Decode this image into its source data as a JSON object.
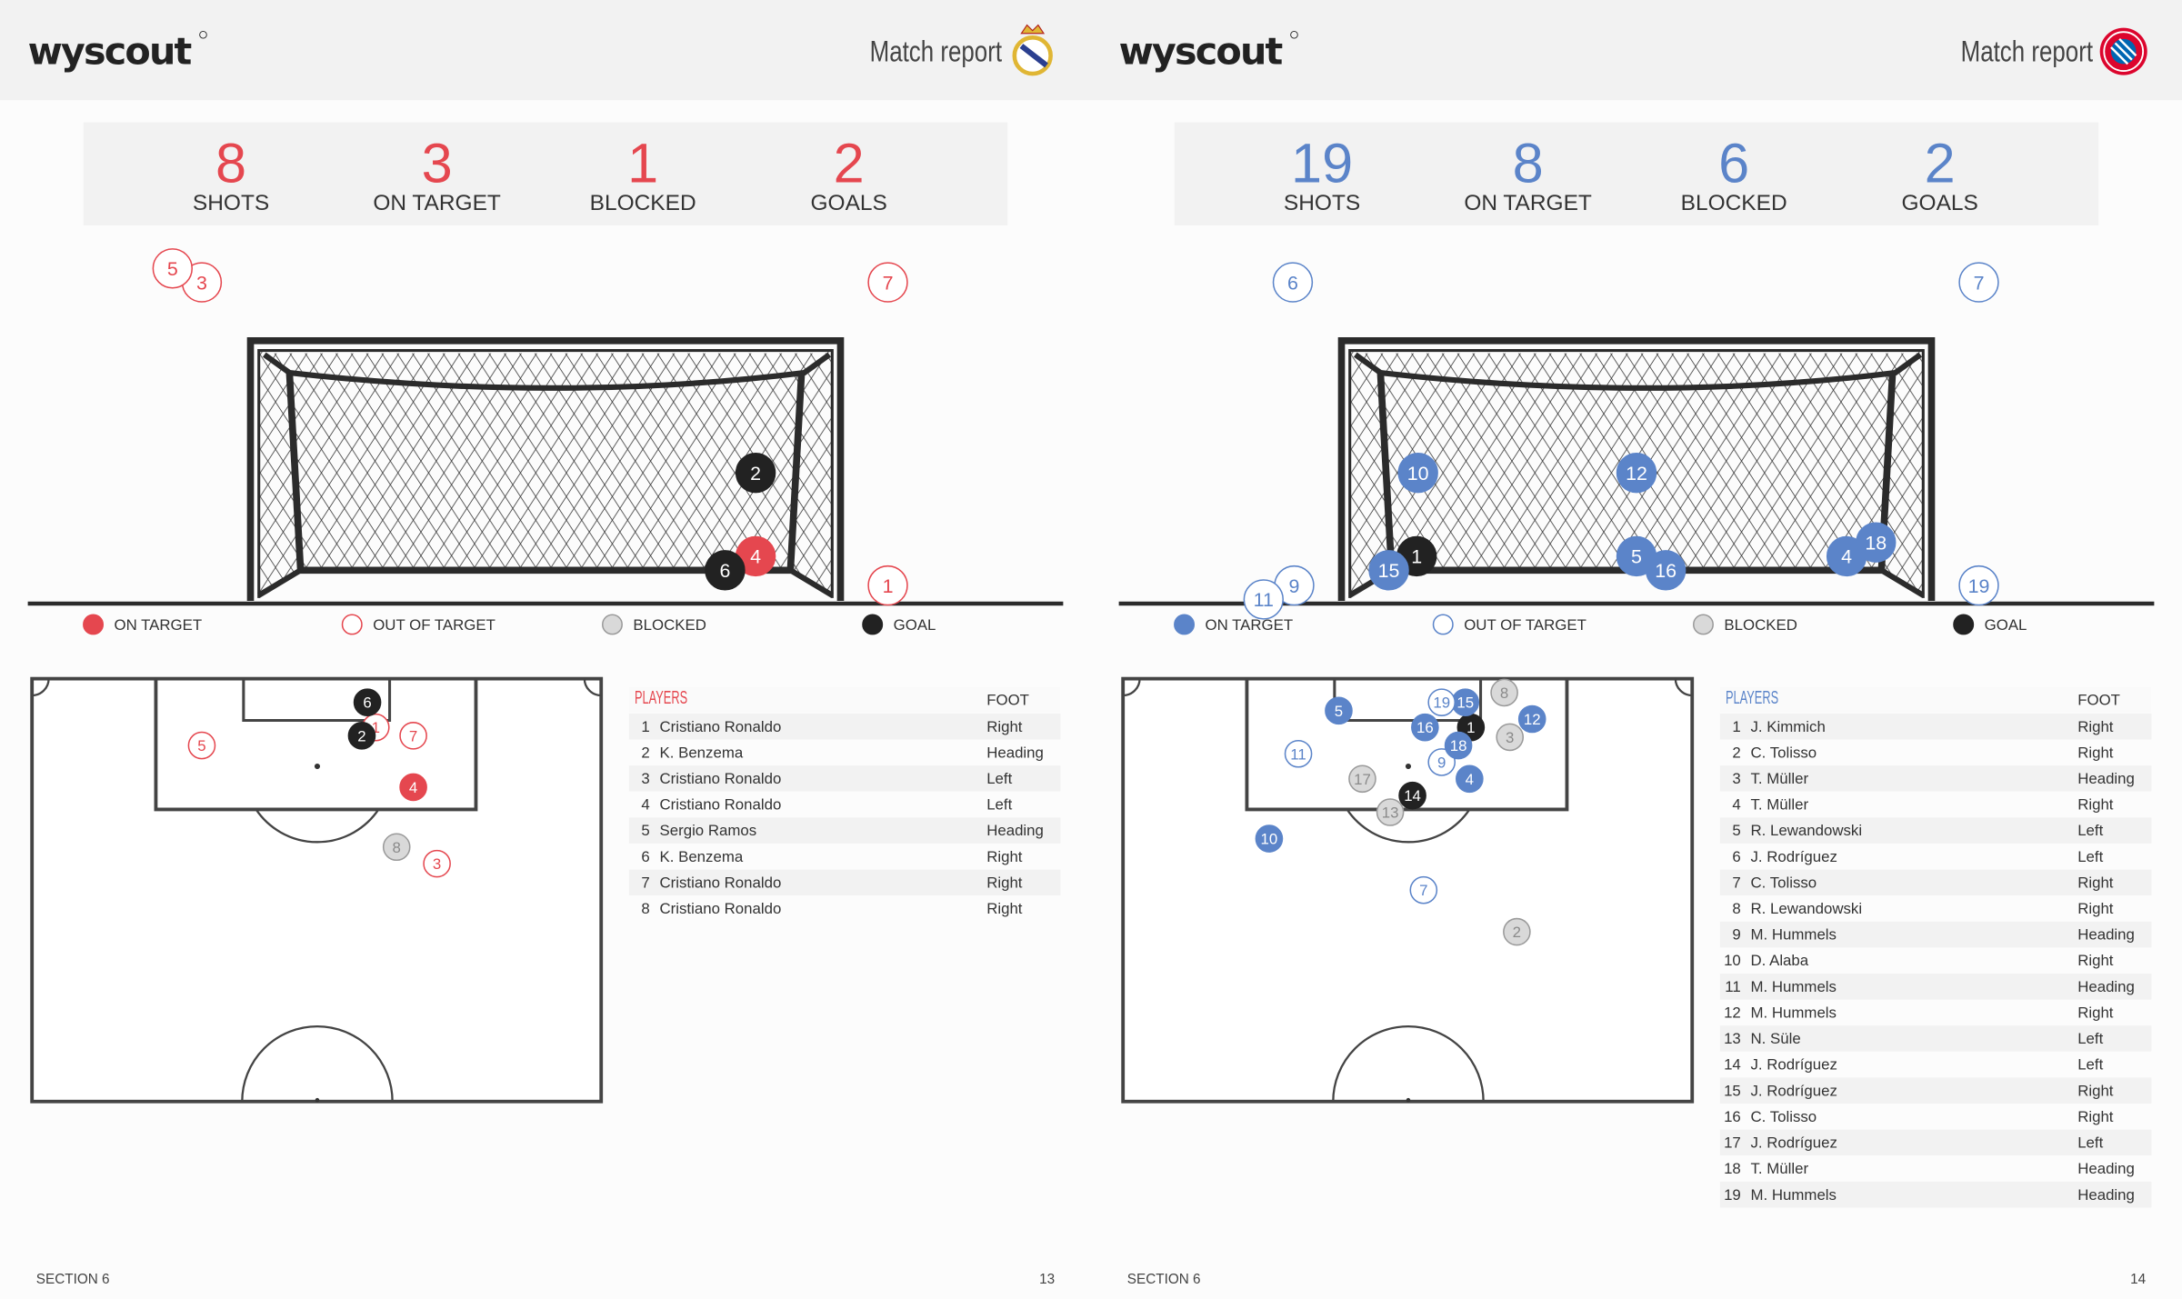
{
  "pages": [
    {
      "brand": "wyscout",
      "title": "Match report",
      "crest_icon": "real-madrid-crest-icon",
      "accent": "#e5474f",
      "stats": [
        {
          "value": "8",
          "label": "SHOTS"
        },
        {
          "value": "3",
          "label": "ON TARGET"
        },
        {
          "value": "1",
          "label": "BLOCKED"
        },
        {
          "value": "2",
          "label": "GOALS"
        }
      ],
      "legend": [
        "ON TARGET",
        "OUT OF TARGET",
        "BLOCKED",
        "GOAL"
      ],
      "shots": [
        {
          "n": "1",
          "outcome": "out"
        },
        {
          "n": "2",
          "outcome": "goal"
        },
        {
          "n": "3",
          "outcome": "out"
        },
        {
          "n": "4",
          "outcome": "on_target"
        },
        {
          "n": "5",
          "outcome": "out"
        },
        {
          "n": "6",
          "outcome": "goal"
        },
        {
          "n": "7",
          "outcome": "out"
        },
        {
          "n": "8",
          "outcome": "blocked"
        }
      ],
      "table": {
        "players_header": "PLAYERS",
        "foot_header": "FOOT",
        "rows": [
          {
            "n": "1",
            "player": "Cristiano Ronaldo",
            "foot": "Right"
          },
          {
            "n": "2",
            "player": "K. Benzema",
            "foot": "Heading"
          },
          {
            "n": "3",
            "player": "Cristiano Ronaldo",
            "foot": "Left"
          },
          {
            "n": "4",
            "player": "Cristiano Ronaldo",
            "foot": "Left"
          },
          {
            "n": "5",
            "player": "Sergio Ramos",
            "foot": "Heading"
          },
          {
            "n": "6",
            "player": "K. Benzema",
            "foot": "Right"
          },
          {
            "n": "7",
            "player": "Cristiano Ronaldo",
            "foot": "Right"
          },
          {
            "n": "8",
            "player": "Cristiano Ronaldo",
            "foot": "Right"
          }
        ]
      },
      "footer": {
        "section": "SECTION 6",
        "page": "13"
      }
    },
    {
      "brand": "wyscout",
      "title": "Match report",
      "crest_icon": "bayern-munich-crest-icon",
      "accent": "#5b84c9",
      "stats": [
        {
          "value": "19",
          "label": "SHOTS"
        },
        {
          "value": "8",
          "label": "ON TARGET"
        },
        {
          "value": "6",
          "label": "BLOCKED"
        },
        {
          "value": "2",
          "label": "GOALS"
        }
      ],
      "legend": [
        "ON TARGET",
        "OUT OF TARGET",
        "BLOCKED",
        "GOAL"
      ],
      "shots": [
        {
          "n": "1",
          "outcome": "goal"
        },
        {
          "n": "2",
          "outcome": "blocked"
        },
        {
          "n": "3",
          "outcome": "blocked"
        },
        {
          "n": "4",
          "outcome": "on_target"
        },
        {
          "n": "5",
          "outcome": "on_target"
        },
        {
          "n": "6",
          "outcome": "out"
        },
        {
          "n": "7",
          "outcome": "out"
        },
        {
          "n": "8",
          "outcome": "blocked"
        },
        {
          "n": "9",
          "outcome": "out"
        },
        {
          "n": "10",
          "outcome": "on_target"
        },
        {
          "n": "11",
          "outcome": "out"
        },
        {
          "n": "12",
          "outcome": "on_target"
        },
        {
          "n": "13",
          "outcome": "blocked"
        },
        {
          "n": "14",
          "outcome": "goal"
        },
        {
          "n": "15",
          "outcome": "on_target"
        },
        {
          "n": "16",
          "outcome": "on_target"
        },
        {
          "n": "17",
          "outcome": "blocked"
        },
        {
          "n": "18",
          "outcome": "on_target"
        },
        {
          "n": "19",
          "outcome": "out"
        }
      ],
      "table": {
        "players_header": "PLAYERS",
        "foot_header": "FOOT",
        "rows": [
          {
            "n": "1",
            "player": "J. Kimmich",
            "foot": "Right"
          },
          {
            "n": "2",
            "player": "C. Tolisso",
            "foot": "Right"
          },
          {
            "n": "3",
            "player": "T. Müller",
            "foot": "Heading"
          },
          {
            "n": "4",
            "player": "T. Müller",
            "foot": "Right"
          },
          {
            "n": "5",
            "player": "R. Lewandowski",
            "foot": "Left"
          },
          {
            "n": "6",
            "player": "J. Rodríguez",
            "foot": "Left"
          },
          {
            "n": "7",
            "player": "C. Tolisso",
            "foot": "Right"
          },
          {
            "n": "8",
            "player": "R. Lewandowski",
            "foot": "Right"
          },
          {
            "n": "9",
            "player": "M. Hummels",
            "foot": "Heading"
          },
          {
            "n": "10",
            "player": "D. Alaba",
            "foot": "Right"
          },
          {
            "n": "11",
            "player": "M. Hummels",
            "foot": "Heading"
          },
          {
            "n": "12",
            "player": "M. Hummels",
            "foot": "Right"
          },
          {
            "n": "13",
            "player": "N. Süle",
            "foot": "Left"
          },
          {
            "n": "14",
            "player": "J. Rodríguez",
            "foot": "Left"
          },
          {
            "n": "15",
            "player": "J. Rodríguez",
            "foot": "Right"
          },
          {
            "n": "16",
            "player": "C. Tolisso",
            "foot": "Right"
          },
          {
            "n": "17",
            "player": "J. Rodríguez",
            "foot": "Left"
          },
          {
            "n": "18",
            "player": "T. Müller",
            "foot": "Heading"
          },
          {
            "n": "19",
            "player": "M. Hummels",
            "foot": "Heading"
          }
        ]
      },
      "footer": {
        "section": "SECTION 6",
        "page": "14"
      }
    }
  ],
  "colors": {
    "goal": "#222222",
    "blocked": "#d9d9d9",
    "header_bg": "#f2f2f2",
    "row_shade": "#f2f2f2"
  }
}
